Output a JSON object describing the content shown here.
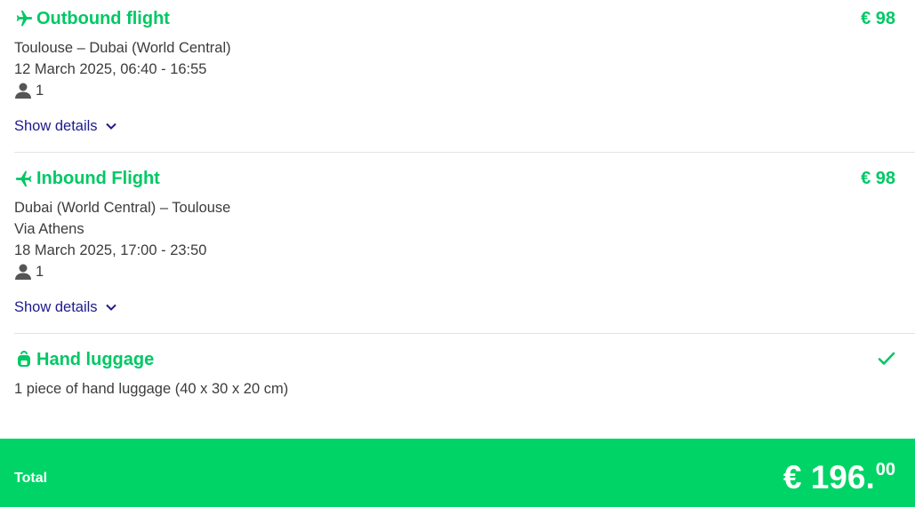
{
  "outbound": {
    "title": "Outbound flight",
    "price": "€ 98",
    "route": "Toulouse – Dubai (World Central)",
    "datetime": "12 March 2025, 06:40 - 16:55",
    "passengers": "1",
    "show_details": "Show details",
    "icon": "plane-icon"
  },
  "inbound": {
    "title": "Inbound Flight",
    "price": "€ 98",
    "route": "Dubai (World Central) – Toulouse",
    "via": "Via Athens",
    "datetime": "18 March 2025, 17:00 - 23:50",
    "passengers": "1",
    "show_details": "Show details",
    "icon": "plane-icon"
  },
  "luggage": {
    "title": "Hand luggage",
    "description": "1 piece of hand luggage (40 x 30 x 20 cm)",
    "icon": "backpack-icon",
    "included_icon": "checkmark-icon"
  },
  "total": {
    "label": "Total",
    "amount_main": "€ 196.",
    "amount_cents": "00"
  },
  "colors": {
    "accent": "#00c864",
    "total_bar": "#00d466",
    "link": "#1e1a8c",
    "text": "#3c3c3c"
  }
}
